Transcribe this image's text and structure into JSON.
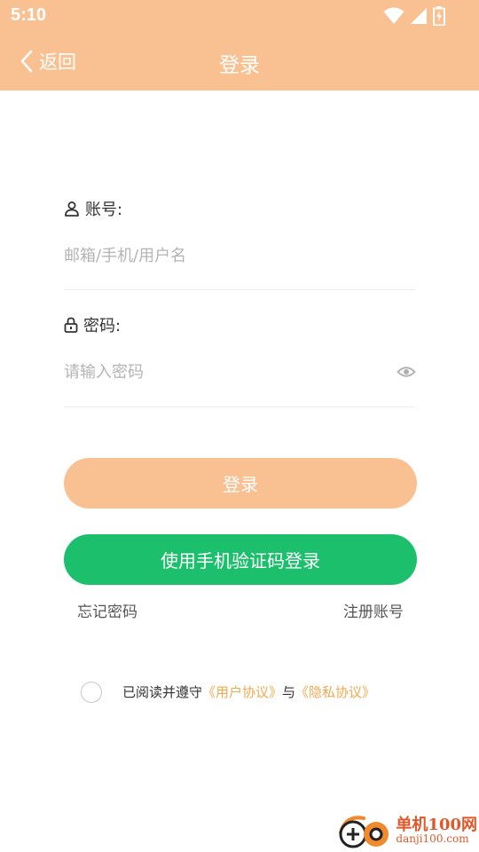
{
  "status_bar": {
    "time": "5:10"
  },
  "nav": {
    "back_label": "返回",
    "title": "登录"
  },
  "account": {
    "label": "账号:",
    "placeholder": "邮箱/手机/用户名"
  },
  "password": {
    "label": "密码:",
    "placeholder": "请输入密码"
  },
  "buttons": {
    "login": "登录",
    "sms_login": "使用手机验证码登录"
  },
  "links": {
    "forgot_password": "忘记密码",
    "register": "注册账号"
  },
  "agreement": {
    "prefix": "已阅读并遵守",
    "user_agreement": "《用户协议》",
    "conjunction": "与",
    "privacy_policy": "《隐私协议》"
  },
  "watermark": {
    "title": "单机100网",
    "url": "danji100.com"
  },
  "colors": {
    "header": "#f9c191",
    "login_button": "#f9c191",
    "sms_button": "#1cbf6b",
    "link": "#f0a94f"
  }
}
